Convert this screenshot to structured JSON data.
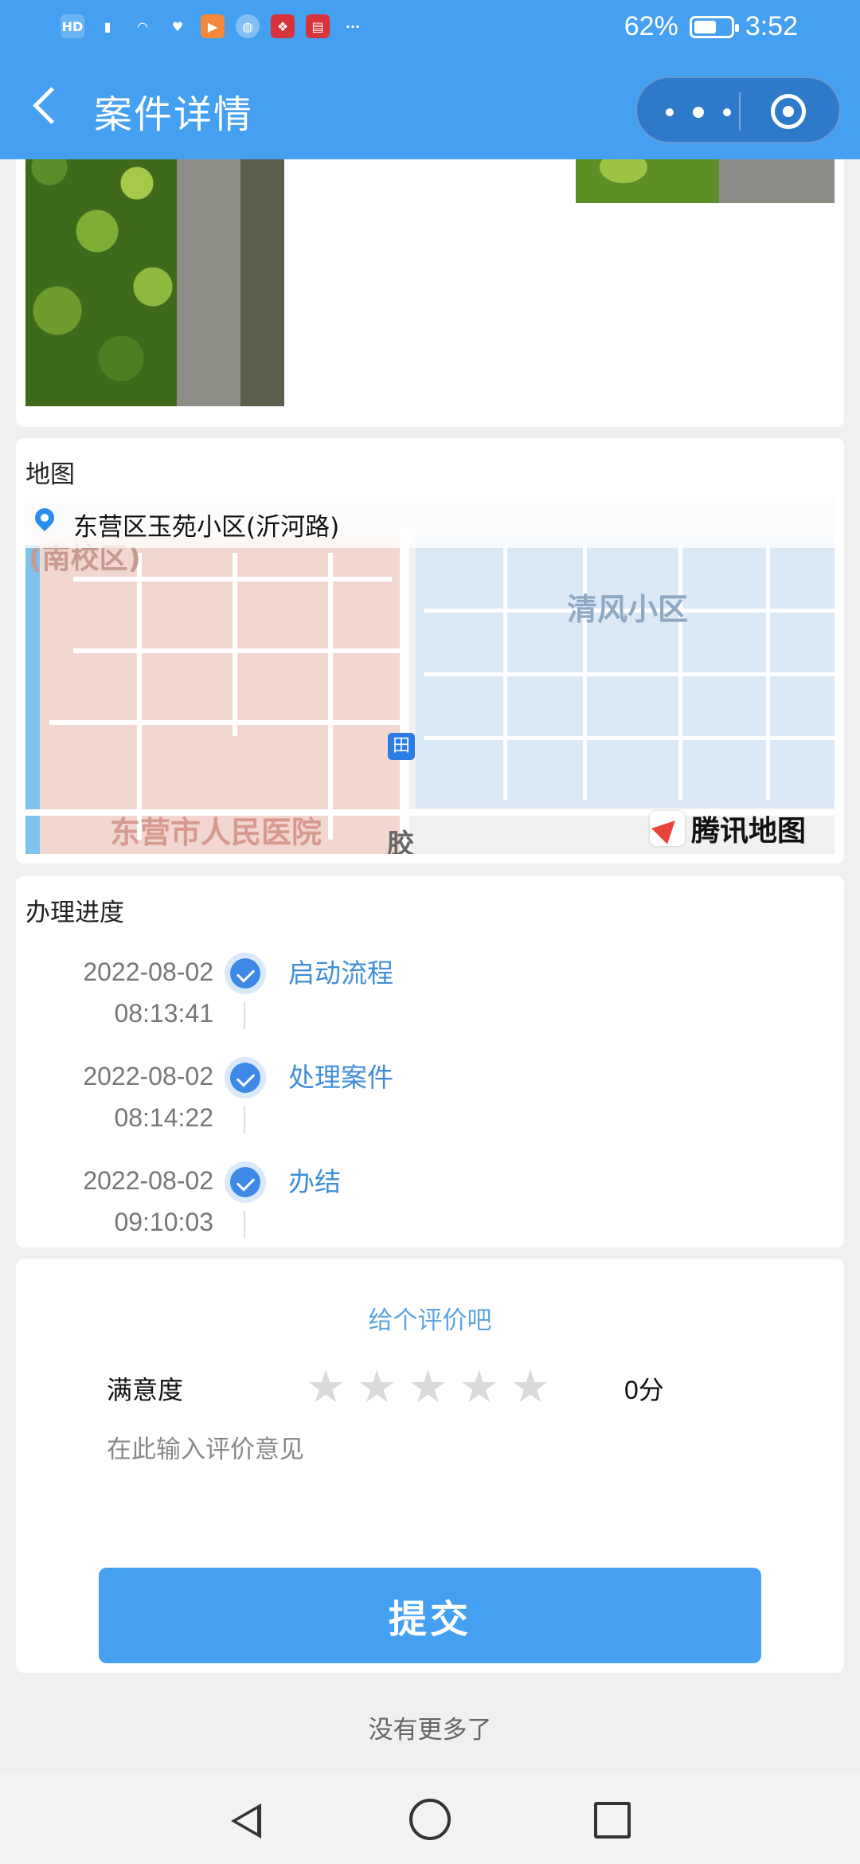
{
  "status_bar": {
    "battery": "62%",
    "battery_level": 0.62,
    "time": "3:52",
    "icons": [
      "hd-icon",
      "signal-4g-icon",
      "wifi-icon",
      "heart-icon",
      "play-app-icon",
      "globe-app-icon",
      "gift-app-icon",
      "book-app-icon",
      "more-dots-icon"
    ]
  },
  "nav": {
    "title": "案件详情",
    "back_icon": "chevron-left-icon",
    "menu_icon": "more-dots-icon",
    "close_icon": "target-circle-icon"
  },
  "map_section": {
    "title": "地图",
    "address": "东营区玉苑小区(沂河路)",
    "labels": {
      "school": "(南校区)",
      "community": "清风小区",
      "hospital": "东营市人民医院",
      "road": "胶",
      "bus": "田"
    },
    "provider": "腾讯地图"
  },
  "progress_section": {
    "title": "办理进度",
    "steps": [
      {
        "date": "2022-08-02",
        "time": "08:13:41",
        "name": "启动流程"
      },
      {
        "date": "2022-08-02",
        "time": "08:14:22",
        "name": "处理案件"
      },
      {
        "date": "2022-08-02",
        "time": "09:10:03",
        "name": "办结"
      }
    ]
  },
  "rating": {
    "title": "给个评价吧",
    "label": "满意度",
    "stars_total": 5,
    "stars_filled": 0,
    "star_glyph": "★",
    "score": "0分",
    "placeholder": "在此输入评价意见",
    "submit": "提交"
  },
  "footer": {
    "no_more": "没有更多了"
  },
  "colors": {
    "primary": "#45a0f2",
    "link": "#3f8fd8",
    "star_empty": "#d9d9d9"
  }
}
